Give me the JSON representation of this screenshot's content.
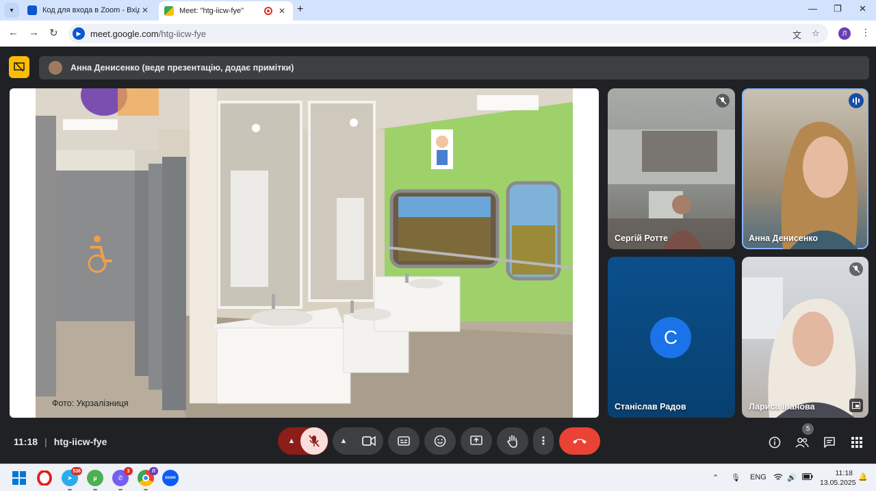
{
  "browser": {
    "tabs": [
      {
        "title": "Код для входа в Zoom - Вхідні",
        "favicon_color": "#0b57d0"
      },
      {
        "title": "Meet: \"htg-iicw-fye\"",
        "favicon_color": "#34a853"
      }
    ],
    "url_host": "meet.google.com",
    "url_path": "/htg-iicw-fye",
    "profile_initial": "Л"
  },
  "presentation": {
    "presenter_label": "Анна Денисенко (веде презентацію, додає примітки)",
    "photo_caption": "Фото: Укрзалізниця"
  },
  "participants": [
    {
      "name": "Сергій Ротте",
      "mic": "muted"
    },
    {
      "name": "Анна Денисенко",
      "mic": "speaking"
    },
    {
      "name": "Станіслав Радов",
      "avatar_letter": "C",
      "mic": "on"
    },
    {
      "name": "Лариса Іванова",
      "mic": "muted"
    }
  ],
  "meeting": {
    "time": "11:18",
    "separator": "|",
    "code": "htg-iicw-fye",
    "people_count": "5"
  },
  "colors": {
    "hangup": "#ea4335",
    "mic_off_bg": "#f9dedc",
    "mic_off_dark": "#8c1d18",
    "speaking": "#174ea6",
    "avatar": "#1a73e8"
  },
  "taskbar": {
    "language": "ENG",
    "clock_time": "11:18",
    "clock_date": "13.05.2025",
    "apps": [
      {
        "name": "windows-start",
        "badge": ""
      },
      {
        "name": "opera",
        "badge": ""
      },
      {
        "name": "telegram",
        "badge": "536"
      },
      {
        "name": "utorrent",
        "badge": ""
      },
      {
        "name": "viber",
        "badge": "3"
      },
      {
        "name": "chrome",
        "badge": "Л"
      },
      {
        "name": "zoom",
        "badge": "",
        "label": "zoom"
      }
    ]
  }
}
